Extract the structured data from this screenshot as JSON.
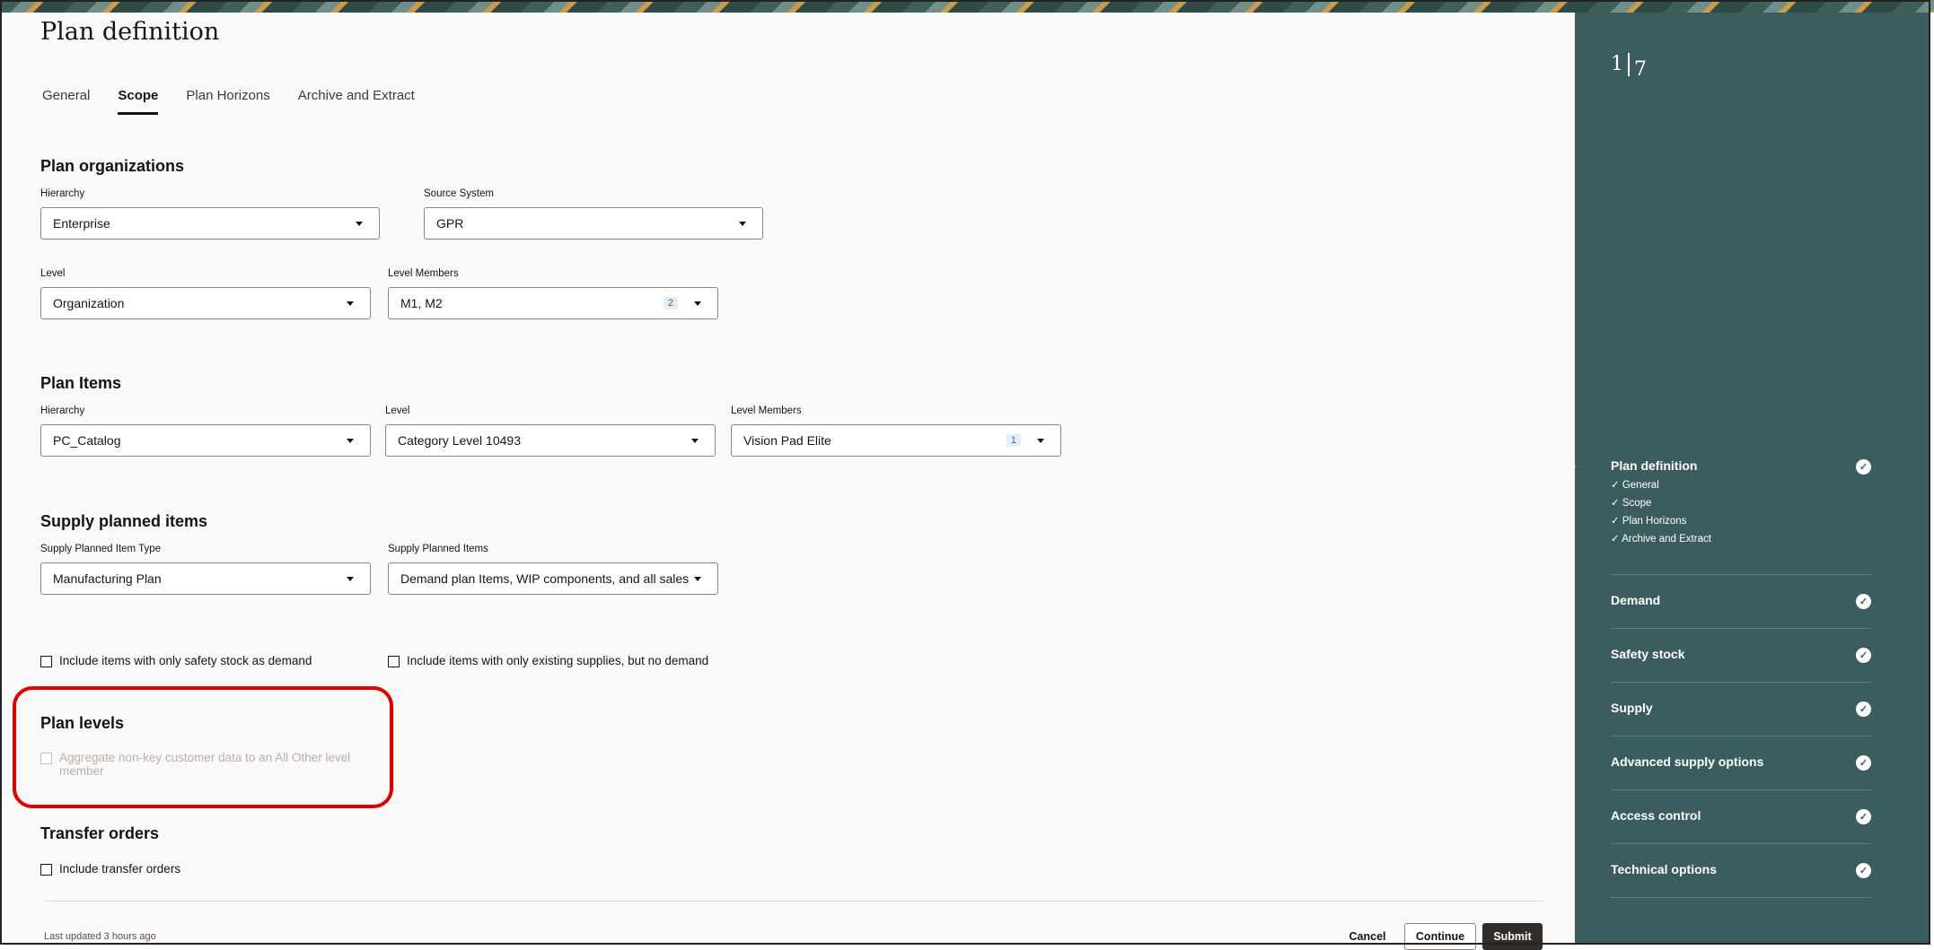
{
  "page": {
    "title": "Plan definition",
    "tabs": [
      "General",
      "Scope",
      "Plan Horizons",
      "Archive and Extract"
    ],
    "active_tab": "Scope"
  },
  "plan_organizations": {
    "title": "Plan organizations",
    "hierarchy_label": "Hierarchy",
    "hierarchy_value": "Enterprise",
    "source_system_label": "Source System",
    "source_system_value": "GPR",
    "level_label": "Level",
    "level_value": "Organization",
    "level_members_label": "Level Members",
    "level_members_value": "M1, M2",
    "level_members_count": "2"
  },
  "plan_items": {
    "title": "Plan Items",
    "hierarchy_label": "Hierarchy",
    "hierarchy_value": "PC_Catalog",
    "level_label": "Level",
    "level_value": "Category Level 10493",
    "level_members_label": "Level Members",
    "level_members_value": "Vision Pad Elite",
    "level_members_count": "1"
  },
  "supply_planned_items": {
    "title": "Supply planned items",
    "type_label": "Supply Planned Item Type",
    "type_value": "Manufacturing Plan",
    "items_label": "Supply Planned Items",
    "items_value": "Demand plan Items, WIP components, and all sales",
    "check_safety_stock": "Include items with only safety stock as demand",
    "check_existing_supplies": "Include items with only existing supplies, but no demand"
  },
  "plan_levels": {
    "title": "Plan levels",
    "aggregate_line1": "Aggregate non-key customer data to an All Other level",
    "aggregate_line2": "member"
  },
  "transfer_orders": {
    "title": "Transfer orders",
    "include_label": "Include transfer orders"
  },
  "footer": {
    "last_updated": "Last updated 3 hours ago",
    "cancel": "Cancel",
    "continue": "Continue",
    "submit": "Submit"
  },
  "sidebar": {
    "step_current": "1",
    "step_total": "7",
    "steps": [
      {
        "name": "Plan definition",
        "subs": [
          "General",
          "Scope",
          "Plan Horizons",
          "Archive and Extract"
        ]
      },
      {
        "name": "Demand"
      },
      {
        "name": "Safety stock"
      },
      {
        "name": "Supply"
      },
      {
        "name": "Advanced supply options"
      },
      {
        "name": "Access control"
      },
      {
        "name": "Technical options"
      }
    ]
  },
  "colors": {
    "sidebar_bg": "#3b5d5f",
    "highlight": "#e10000",
    "submit_bg": "#312d2a"
  }
}
